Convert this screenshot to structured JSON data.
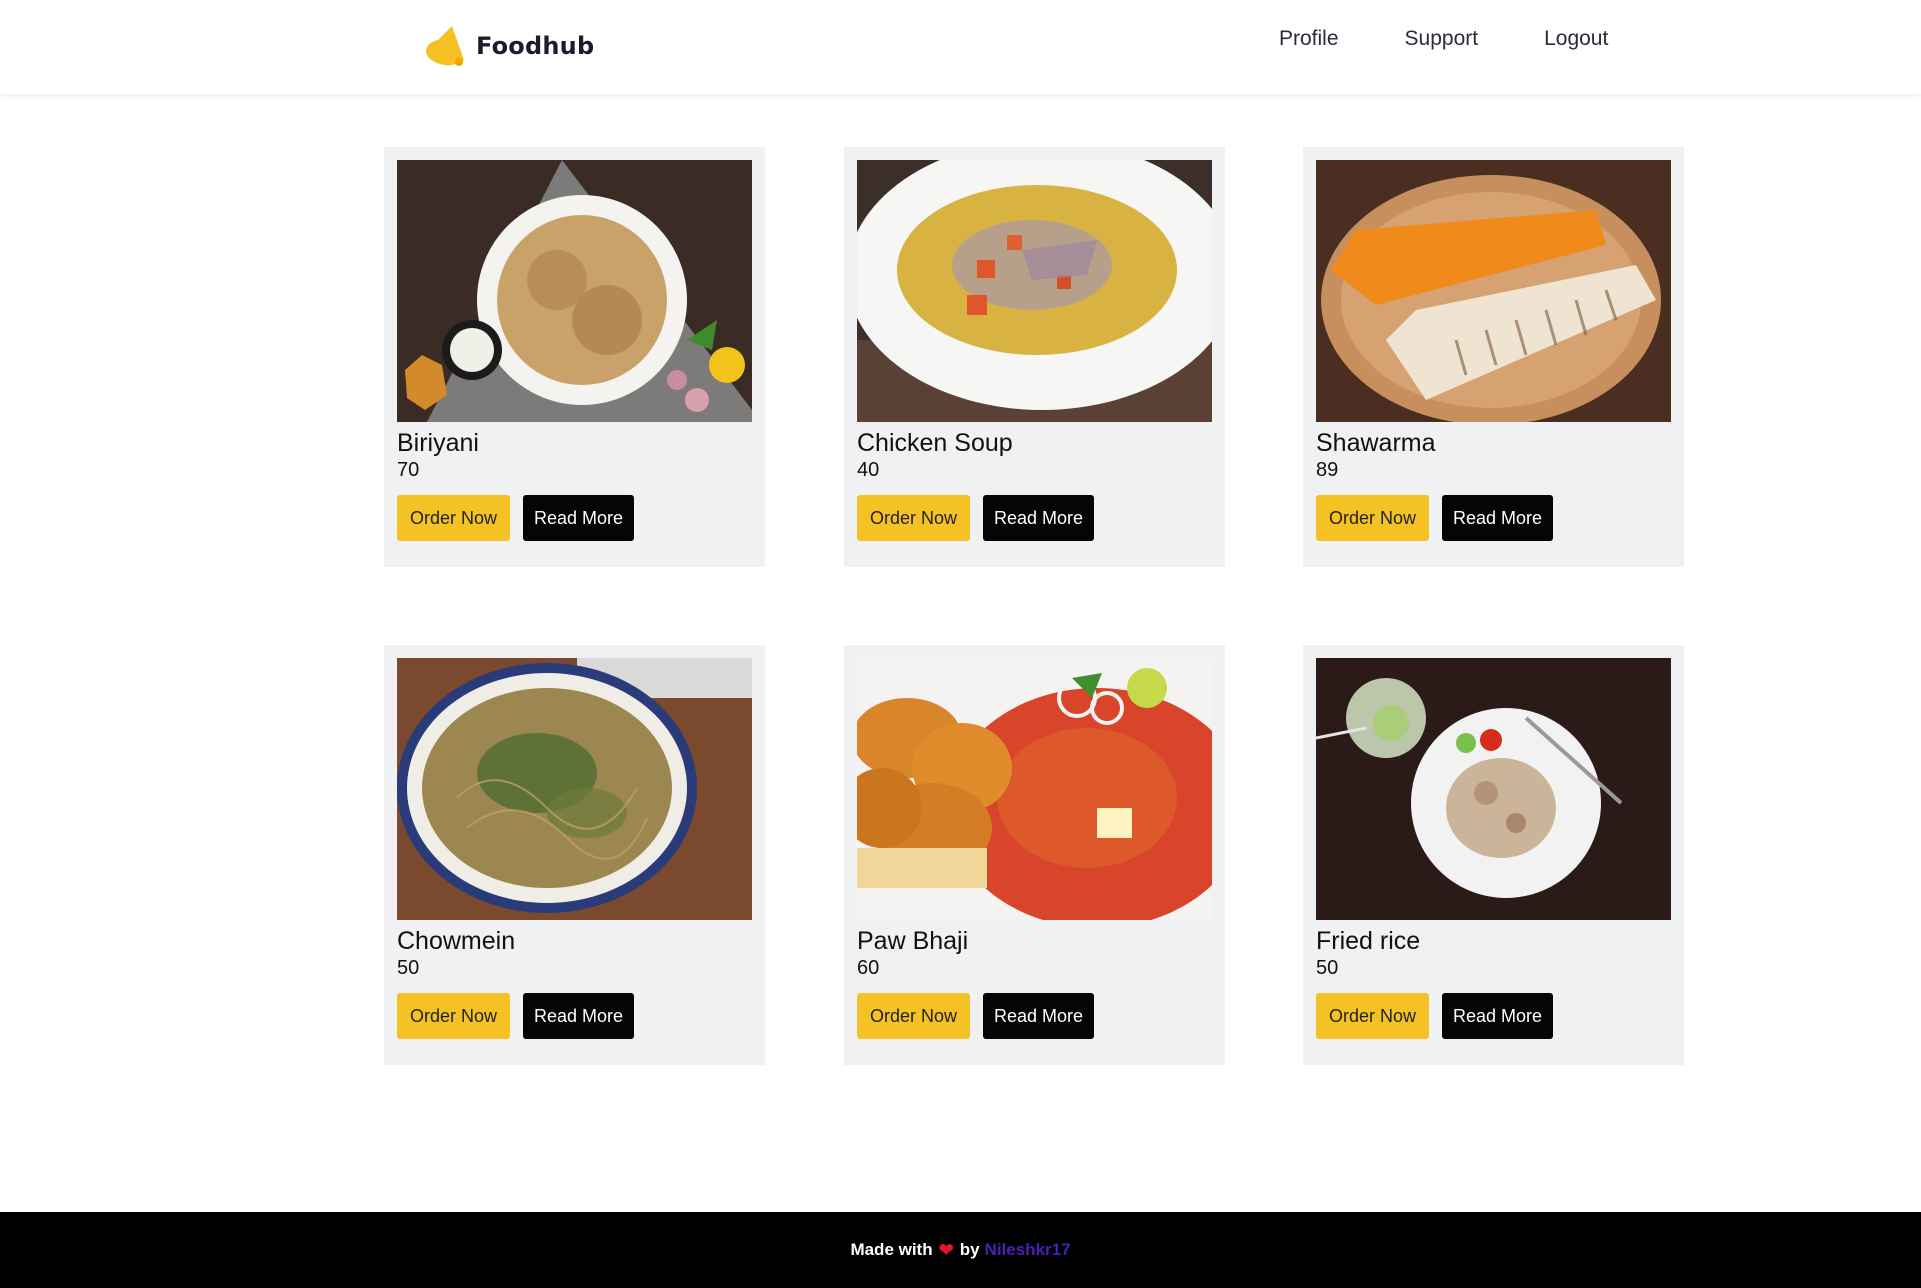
{
  "brand": {
    "name": "Foodhub",
    "accent": "#f5c226"
  },
  "nav": {
    "items": [
      "Profile",
      "Support",
      "Logout"
    ]
  },
  "products": [
    {
      "name": "Biriyani",
      "price": "70",
      "image": "biriyani-photo"
    },
    {
      "name": "Chicken Soup",
      "price": "40",
      "image": "chicken-soup-photo"
    },
    {
      "name": "Shawarma",
      "price": "89",
      "image": "shawarma-photo"
    },
    {
      "name": "Chowmein",
      "price": "50",
      "image": "chowmein-photo"
    },
    {
      "name": "Paw Bhaji",
      "price": "60",
      "image": "paw-bhaji-photo"
    },
    {
      "name": "Fried rice",
      "price": "50",
      "image": "fried-rice-photo"
    }
  ],
  "buttons": {
    "order": "Order Now",
    "read": "Read More"
  },
  "footer": {
    "made_with": "Made with",
    "by": "by",
    "author": "Nileshkr17",
    "heart_color": "#e0162b"
  }
}
